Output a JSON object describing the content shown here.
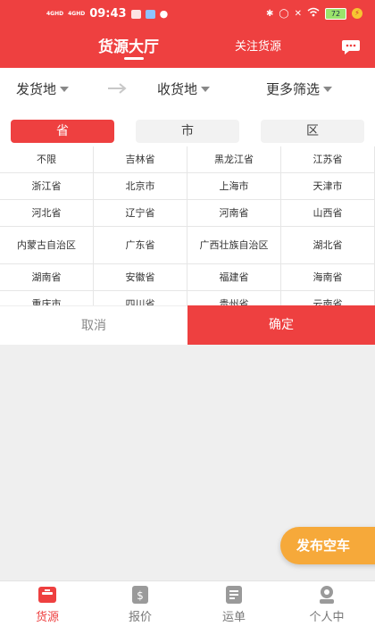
{
  "status_bar": {
    "network_1": "4GHD",
    "network_2": "4GHD",
    "time": "09:43",
    "battery": "72"
  },
  "header": {
    "tab_active": "货源大厅",
    "tab_follow": "关注货源",
    "chat_icon": "chat-bubble-icon"
  },
  "filters": {
    "origin": "发货地",
    "destination": "收货地",
    "more": "更多筛选"
  },
  "region_levels": [
    "省",
    "市",
    "区"
  ],
  "provinces": [
    "不限",
    "吉林省",
    "黑龙江省",
    "江苏省",
    "浙江省",
    "北京市",
    "上海市",
    "天津市",
    "河北省",
    "辽宁省",
    "河南省",
    "山西省",
    "内蒙古自治区",
    "广东省",
    "广西壮族自治区",
    "湖北省",
    "湖南省",
    "安徽省",
    "福建省",
    "海南省",
    "重庆市",
    "四川省",
    "贵州省",
    "云南省"
  ],
  "actions": {
    "cancel": "取消",
    "confirm": "确定"
  },
  "publish_button": "发布空车",
  "bottom_nav": [
    {
      "label": "货源",
      "icon": "cargo-box-icon",
      "active": true
    },
    {
      "label": "报价",
      "icon": "price-tag-icon",
      "active": false
    },
    {
      "label": "运单",
      "icon": "waybill-icon",
      "active": false
    },
    {
      "label": "个人中",
      "icon": "profile-icon",
      "active": false
    }
  ],
  "colors": {
    "brand_red": "#ee4040",
    "publish_orange": "#f6a93a"
  }
}
